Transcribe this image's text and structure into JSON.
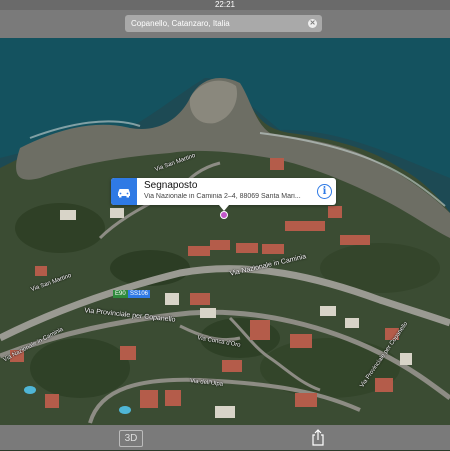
{
  "status": {
    "time": "22:21"
  },
  "search": {
    "value": "Copanello, Catanzaro, Italia"
  },
  "callout": {
    "title": "Segnaposto",
    "address": "Via Nazionale in Caminia 2–4, 88069 Santa Mari...",
    "icon": "car-icon",
    "info_icon": "info-icon"
  },
  "map_labels": {
    "road1": "Via Nazionale in Caminia",
    "road2": "Via Provinciale per Copanello",
    "road3": "Via Provinciale per Copanello",
    "road4": "Via San Martino",
    "road5": "Via Conca d'Oro",
    "road6": "Via dell'Ulpa",
    "road7": "Via Nazionale in Caminia",
    "road8": "Via San Martino",
    "shield1": "E90",
    "shield2": "SS106"
  },
  "bottom": {
    "view_3d": "3D",
    "share_icon": "share-icon"
  },
  "colors": {
    "accent": "#2f7ae5",
    "pin": "#c256c9",
    "bar": "#7a7a7a"
  }
}
